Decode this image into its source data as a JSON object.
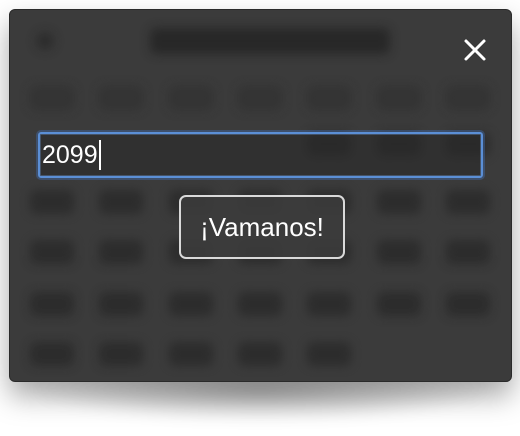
{
  "dialog": {
    "year_input": {
      "value": "2099"
    },
    "go_button_label": "¡Vamanos!",
    "close_icon": "close-icon",
    "colors": {
      "background": "#3b3b3b",
      "input_focus_border": "#5b8fd6",
      "button_border": "#d9d9d9",
      "text": "#ffffff"
    }
  }
}
